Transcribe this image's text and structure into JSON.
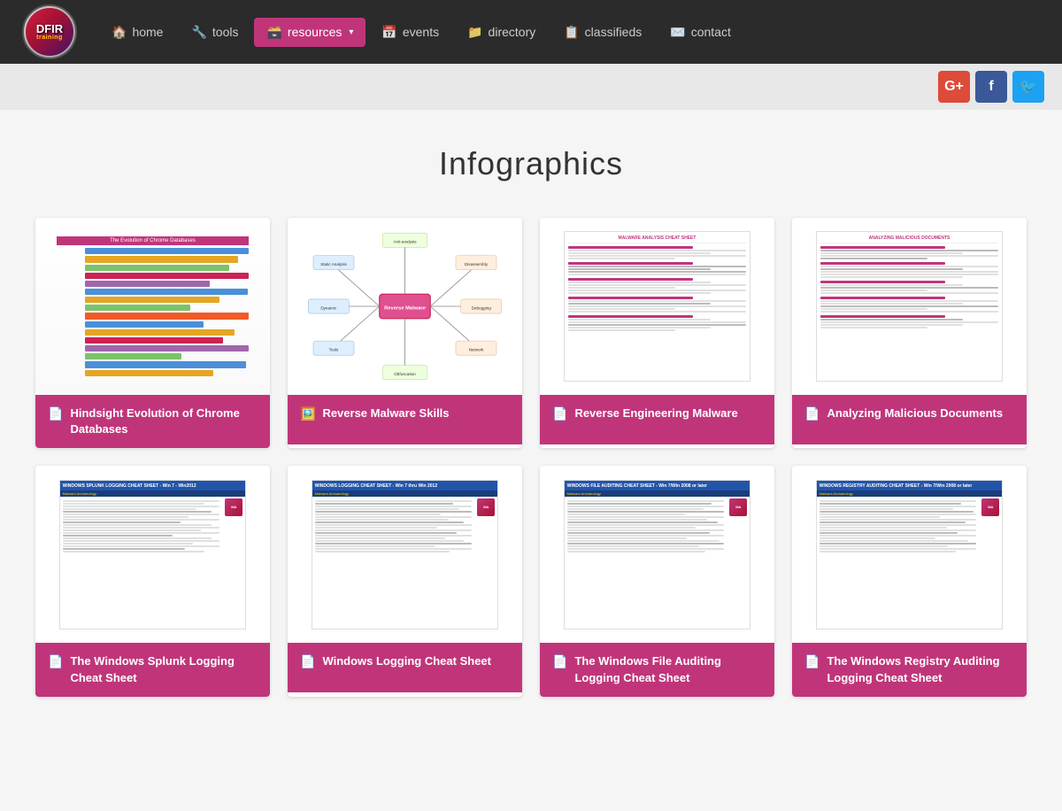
{
  "site": {
    "logo_text": "DFIR",
    "logo_sub": "training"
  },
  "nav": {
    "items": [
      {
        "id": "home",
        "label": "home",
        "icon": "🏠",
        "active": false
      },
      {
        "id": "tools",
        "label": "tools",
        "icon": "🔧",
        "active": false
      },
      {
        "id": "resources",
        "label": "resources",
        "icon": "🗃️",
        "active": true,
        "hasArrow": true
      },
      {
        "id": "events",
        "label": "events",
        "icon": "📅",
        "active": false
      },
      {
        "id": "directory",
        "label": "directory",
        "icon": "📁",
        "active": false
      },
      {
        "id": "classifieds",
        "label": "classifieds",
        "icon": "📋",
        "active": false
      },
      {
        "id": "contact",
        "label": "contact",
        "icon": "✉️",
        "active": false
      }
    ]
  },
  "social": {
    "gplus_label": "G+",
    "fb_label": "f",
    "tw_label": "🐦"
  },
  "page": {
    "title": "Infographics"
  },
  "cards": [
    {
      "id": "card-1",
      "title": "Hindsight Evolution of Chrome Databases",
      "type": "pdf",
      "thumb_type": "chrome"
    },
    {
      "id": "card-2",
      "title": "Reverse Malware Skills",
      "type": "image",
      "thumb_type": "mindmap"
    },
    {
      "id": "card-3",
      "title": "Reverse Engineering Malware",
      "type": "pdf",
      "thumb_type": "malware"
    },
    {
      "id": "card-4",
      "title": "Analyzing Malicious Documents",
      "type": "pdf",
      "thumb_type": "docs"
    },
    {
      "id": "card-5",
      "title": "The Windows Splunk Logging Cheat Sheet",
      "type": "pdf",
      "thumb_type": "splunk"
    },
    {
      "id": "card-6",
      "title": "Windows Logging Cheat Sheet",
      "type": "pdf",
      "thumb_type": "logging"
    },
    {
      "id": "card-7",
      "title": "The Windows File Auditing Logging Cheat Sheet",
      "type": "pdf",
      "thumb_type": "fileaudit"
    },
    {
      "id": "card-8",
      "title": "The Windows Registry Auditing Logging Cheat Sheet",
      "type": "pdf",
      "thumb_type": "registry"
    }
  ],
  "icons": {
    "pdf_icon": "📄",
    "image_icon": "🖼️"
  }
}
